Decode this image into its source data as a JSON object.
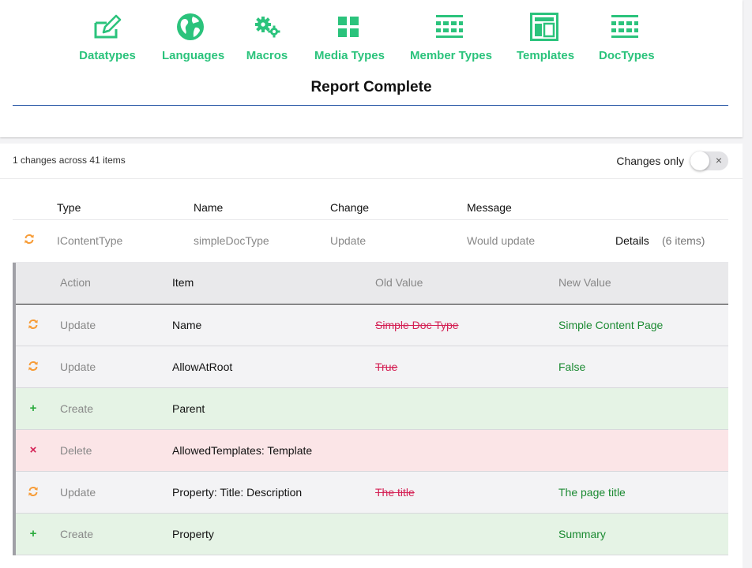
{
  "nav": {
    "items": [
      {
        "label": "Datatypes",
        "icon": "pencil-box-icon"
      },
      {
        "label": "Languages",
        "icon": "globe-icon"
      },
      {
        "label": "Macros",
        "icon": "gears-icon"
      },
      {
        "label": "Media Types",
        "icon": "grid-icon"
      },
      {
        "label": "Member Types",
        "icon": "list-grid-icon"
      },
      {
        "label": "Templates",
        "icon": "template-layout-icon"
      },
      {
        "label": "DocTypes",
        "icon": "list-grid-icon"
      }
    ]
  },
  "report": {
    "title": "Report Complete"
  },
  "summary": {
    "text": "1 changes across 41 items"
  },
  "filter": {
    "label": "Changes only",
    "toggle_on": false,
    "toggle_icon": "×"
  },
  "results": {
    "columns": [
      "Type",
      "Name",
      "Change",
      "Message"
    ],
    "row": {
      "type": "IContentType",
      "name": "simpleDocType",
      "change": "Update",
      "message": "Would update",
      "details_label": "Details",
      "details_count": "(6 items)"
    }
  },
  "details": {
    "columns": {
      "action": "Action",
      "item": "Item",
      "old": "Old Value",
      "new": "New Value"
    },
    "rows": [
      {
        "kind": "update",
        "icon": "refresh-icon",
        "action": "Update",
        "item": "Name",
        "old": "Simple Doc Type",
        "new": "Simple Content Page"
      },
      {
        "kind": "update",
        "icon": "refresh-icon",
        "action": "Update",
        "item": "AllowAtRoot",
        "old": "True",
        "new": "False"
      },
      {
        "kind": "create",
        "icon": "plus-icon",
        "action": "Create",
        "item": "Parent",
        "old": "",
        "new": ""
      },
      {
        "kind": "delete",
        "icon": "close-icon",
        "action": "Delete",
        "item": "AllowedTemplates: Template",
        "old": "",
        "new": ""
      },
      {
        "kind": "update",
        "icon": "refresh-icon",
        "action": "Update",
        "item": "Property: Title: Description",
        "old": "The title",
        "new": "The page title"
      },
      {
        "kind": "create",
        "icon": "plus-icon",
        "action": "Create",
        "item": "Property",
        "old": "",
        "new": "Summary"
      }
    ]
  },
  "colors": {
    "accent_green": "#2bc37c",
    "update_orange": "#f79c37",
    "delete_red": "#d42054",
    "new_value_green": "#1b8a32",
    "title_rule_blue": "#2152a3"
  }
}
